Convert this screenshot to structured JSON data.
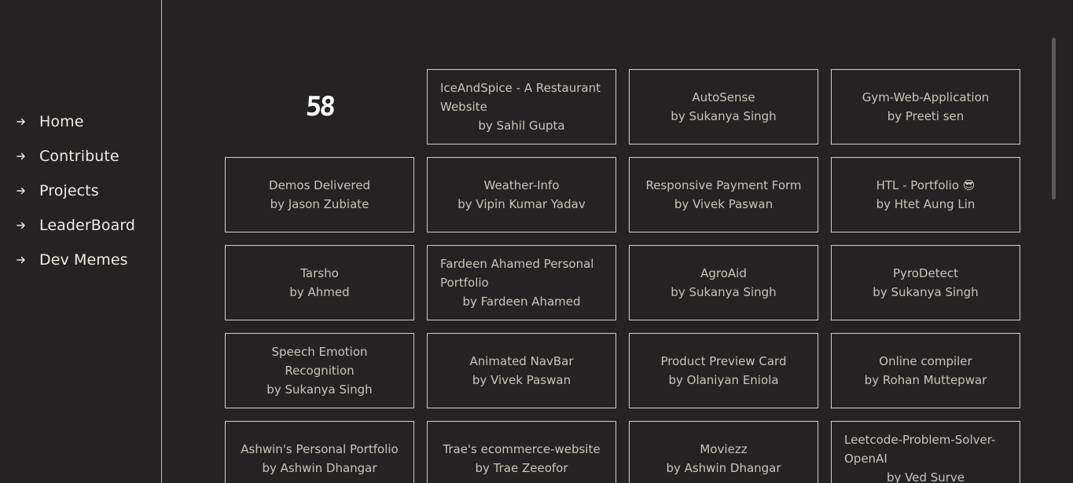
{
  "sidebar": {
    "items": [
      {
        "label": "Home",
        "icon": "arrow-right-icon"
      },
      {
        "label": "Contribute",
        "icon": "arrow-right-icon"
      },
      {
        "label": "Projects",
        "icon": "arrow-right-icon"
      },
      {
        "label": "LeaderBoard",
        "icon": "arrow-right-icon"
      },
      {
        "label": "Dev Memes",
        "icon": "arrow-right-icon"
      }
    ]
  },
  "main": {
    "counter": "58",
    "projects": [
      {
        "title": "IceAndSpice - A Restaurant Website",
        "author": "by Sahil Gupta"
      },
      {
        "title": "AutoSense",
        "author": "by Sukanya Singh"
      },
      {
        "title": "Gym-Web-Application",
        "author": "by Preeti sen"
      },
      {
        "title": "Demos Delivered",
        "author": "by Jason Zubiate"
      },
      {
        "title": "Weather-Info",
        "author": "by Vipin Kumar Yadav"
      },
      {
        "title": "Responsive Payment Form",
        "author": "by Vivek Paswan"
      },
      {
        "title": "HTL - Portfolio 😎",
        "author": "by Htet Aung Lin"
      },
      {
        "title": "Tarsho",
        "author": "by Ahmed"
      },
      {
        "title": "Fardeen Ahamed Personal Portfolio",
        "author": "by Fardeen Ahamed"
      },
      {
        "title": "AgroAid",
        "author": "by Sukanya Singh"
      },
      {
        "title": "PyroDetect",
        "author": "by Sukanya Singh"
      },
      {
        "title": "Speech Emotion Recognition",
        "author": "by Sukanya Singh"
      },
      {
        "title": "Animated NavBar",
        "author": "by Vivek Paswan"
      },
      {
        "title": "Product Preview Card",
        "author": "by Olaniyan Eniola"
      },
      {
        "title": "Online compiler",
        "author": "by Rohan Muttepwar"
      },
      {
        "title": "Ashwin's Personal Portfolio",
        "author": "by Ashwin Dhangar"
      },
      {
        "title": "Trae's ecommerce-website",
        "author": "by Trae Zeeofor"
      },
      {
        "title": "Moviezz",
        "author": "by Ashwin Dhangar"
      },
      {
        "title": "Leetcode-Problem-Solver-OpenAI",
        "author": "by Ved Surve"
      }
    ]
  },
  "colors": {
    "background": "#252223",
    "border": "#d6cfc7",
    "text": "#c9c4bd",
    "nav_text": "#efebe6"
  }
}
